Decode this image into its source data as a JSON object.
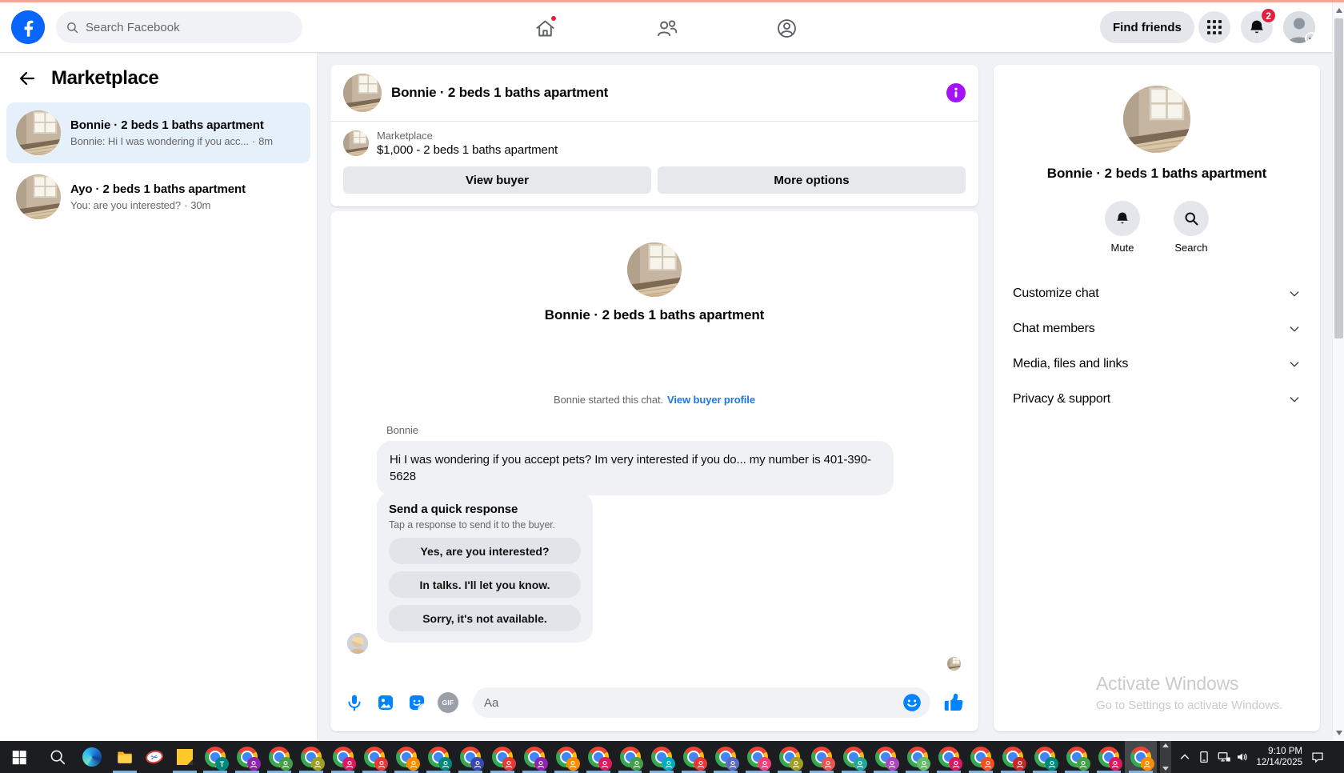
{
  "topbar": {
    "search_placeholder": "Search Facebook",
    "find_friends": "Find friends",
    "notifications_badge": "2"
  },
  "sidebar": {
    "title": "Marketplace",
    "conversations": [
      {
        "title": "Bonnie · 2 beds 1 baths apartment",
        "snippet": "Bonnie: Hi I was wondering if you acc...",
        "time": "8m",
        "selected": true
      },
      {
        "title": "Ayo · 2 beds 1 baths apartment",
        "snippet": "You: are you interested?",
        "time": "30m",
        "selected": false
      }
    ]
  },
  "chat": {
    "header": {
      "title": "Bonnie · 2 beds 1 baths apartment"
    },
    "listing": {
      "source": "Marketplace",
      "price_line": "$1,000 - 2 beds 1 baths apartment",
      "view_buyer": "View buyer",
      "more_options": "More options"
    },
    "intro": {
      "title": "Bonnie · 2 beds 1 baths apartment",
      "started": "Bonnie started this chat.",
      "link": "View buyer profile"
    },
    "message": {
      "sender": "Bonnie",
      "text": "Hi I was wondering if you accept pets? Im very interested if you do... my number is 401-390-5628"
    },
    "quick": {
      "title": "Send a quick response",
      "subtitle": "Tap a response to send it to the buyer.",
      "options": [
        "Yes, are you interested?",
        "In talks. I'll let you know.",
        "Sorry, it's not available."
      ]
    },
    "composer": {
      "placeholder": "Aa",
      "gif_label": "GIF"
    }
  },
  "details": {
    "title": "Bonnie · 2 beds 1 baths apartment",
    "mute": "Mute",
    "search": "Search",
    "menu": [
      "Customize chat",
      "Chat members",
      "Media, files and links",
      "Privacy & support"
    ],
    "watermark": {
      "line1": "Activate Windows",
      "line2": "Go to Settings to activate Windows."
    }
  },
  "taskbar": {
    "time": "9:10 PM",
    "date": "12/14/2025",
    "chrome_badges": [
      {
        "letter": "T",
        "color": "#00897b"
      },
      {
        "color": "#8e24aa"
      },
      {
        "color": "#43a047"
      },
      {
        "color": "#9e9d24"
      },
      {
        "color": "#d81b60"
      },
      {
        "color": "#e53935"
      },
      {
        "color": "#fb8c00"
      },
      {
        "color": "#00897b"
      },
      {
        "color": "#3949ab"
      },
      {
        "color": "#e53935"
      },
      {
        "color": "#8e24aa"
      },
      {
        "color": "#fb8c00"
      },
      {
        "color": "#d81b60"
      },
      {
        "color": "#43a047"
      },
      {
        "color": "#00acc1"
      },
      {
        "color": "#e53935"
      },
      {
        "color": "#5c6bc0"
      },
      {
        "color": "#ec407a"
      },
      {
        "color": "#9e9d24"
      },
      {
        "color": "#ef5350"
      },
      {
        "color": "#26a69a"
      },
      {
        "color": "#ab47bc"
      },
      {
        "color": "#66bb6a"
      },
      {
        "color": "#d81b60"
      },
      {
        "color": "#f4511e"
      },
      {
        "color": "#c62828"
      },
      {
        "color": "#00897b"
      },
      {
        "color": "#43a047"
      },
      {
        "color": "#d81b60"
      },
      {
        "color": "#fb8c00",
        "active": true
      }
    ]
  },
  "icons": {
    "fb_logo": "f-circle",
    "search": "magnifier",
    "home": "house+red-dot",
    "friends": "two-people",
    "groups": "person-in-circle",
    "apps": "9-dot-grid",
    "notifications": "bell",
    "info": "purple-i",
    "mic": "microphone",
    "photo": "image",
    "sticker": "sticker-smiley",
    "emoji": "smiley",
    "like": "thumbs-up"
  },
  "colors": {
    "fb_blue": "#0866ff",
    "messenger_blue": "#0084ff",
    "accent_purple": "#a412f7",
    "badge_red": "#e41e3f",
    "selected_row_blue": "#e6f0fb",
    "link_blue": "#1877f2",
    "taskbar_underline": "#7fb3dc",
    "top_strip": "#f2a78f"
  }
}
